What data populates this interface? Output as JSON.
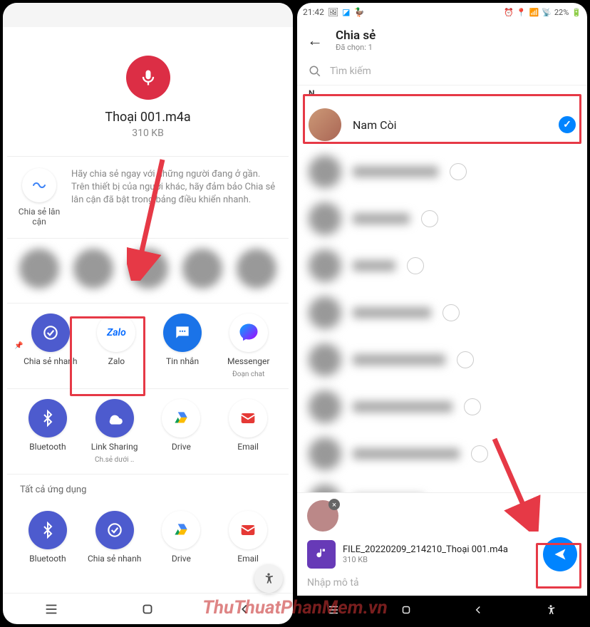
{
  "left": {
    "file_name": "Thoại 001.m4a",
    "file_size": "310 KB",
    "nearby_label": "Chia sẻ lân cận",
    "nearby_text": "Hãy chia sẻ ngay với những người đang ở gần. Trên thiết bị của người khác, hãy đảm bảo Chia sẻ lân cận đã bật trong bảng điều khiển nhanh.",
    "apps_row1": [
      {
        "label": "Chia sẻ nhanh",
        "sub": ""
      },
      {
        "label": "Zalo",
        "sub": ""
      },
      {
        "label": "Tin nhắn",
        "sub": ""
      },
      {
        "label": "Messenger",
        "sub": "Đoạn chat"
      }
    ],
    "apps_row2": [
      {
        "label": "Bluetooth",
        "sub": ""
      },
      {
        "label": "Link Sharing",
        "sub": "Ch.sẻ dưới .."
      },
      {
        "label": "Drive",
        "sub": ""
      },
      {
        "label": "Email",
        "sub": ""
      }
    ],
    "all_apps_label": "Tất cả ứng dụng",
    "apps_row3": [
      {
        "label": "Bluetooth"
      },
      {
        "label": "Chia sẻ nhanh"
      },
      {
        "label": "Drive"
      },
      {
        "label": "Email"
      }
    ]
  },
  "right": {
    "status_time": "21:42",
    "status_battery": "22%",
    "header_title": "Chia sẻ",
    "header_sub": "Đã chọn: 1",
    "search_placeholder": "Tìm kiếm",
    "section_letter": "N",
    "contact_name": "Nam Còi",
    "file_name": "FILE_20220209_214210_Thoại 001.m4a",
    "file_size": "310 KB",
    "caption_placeholder": "Nhập mô tả"
  },
  "watermark": "ThuThuatPhanMem.vn"
}
